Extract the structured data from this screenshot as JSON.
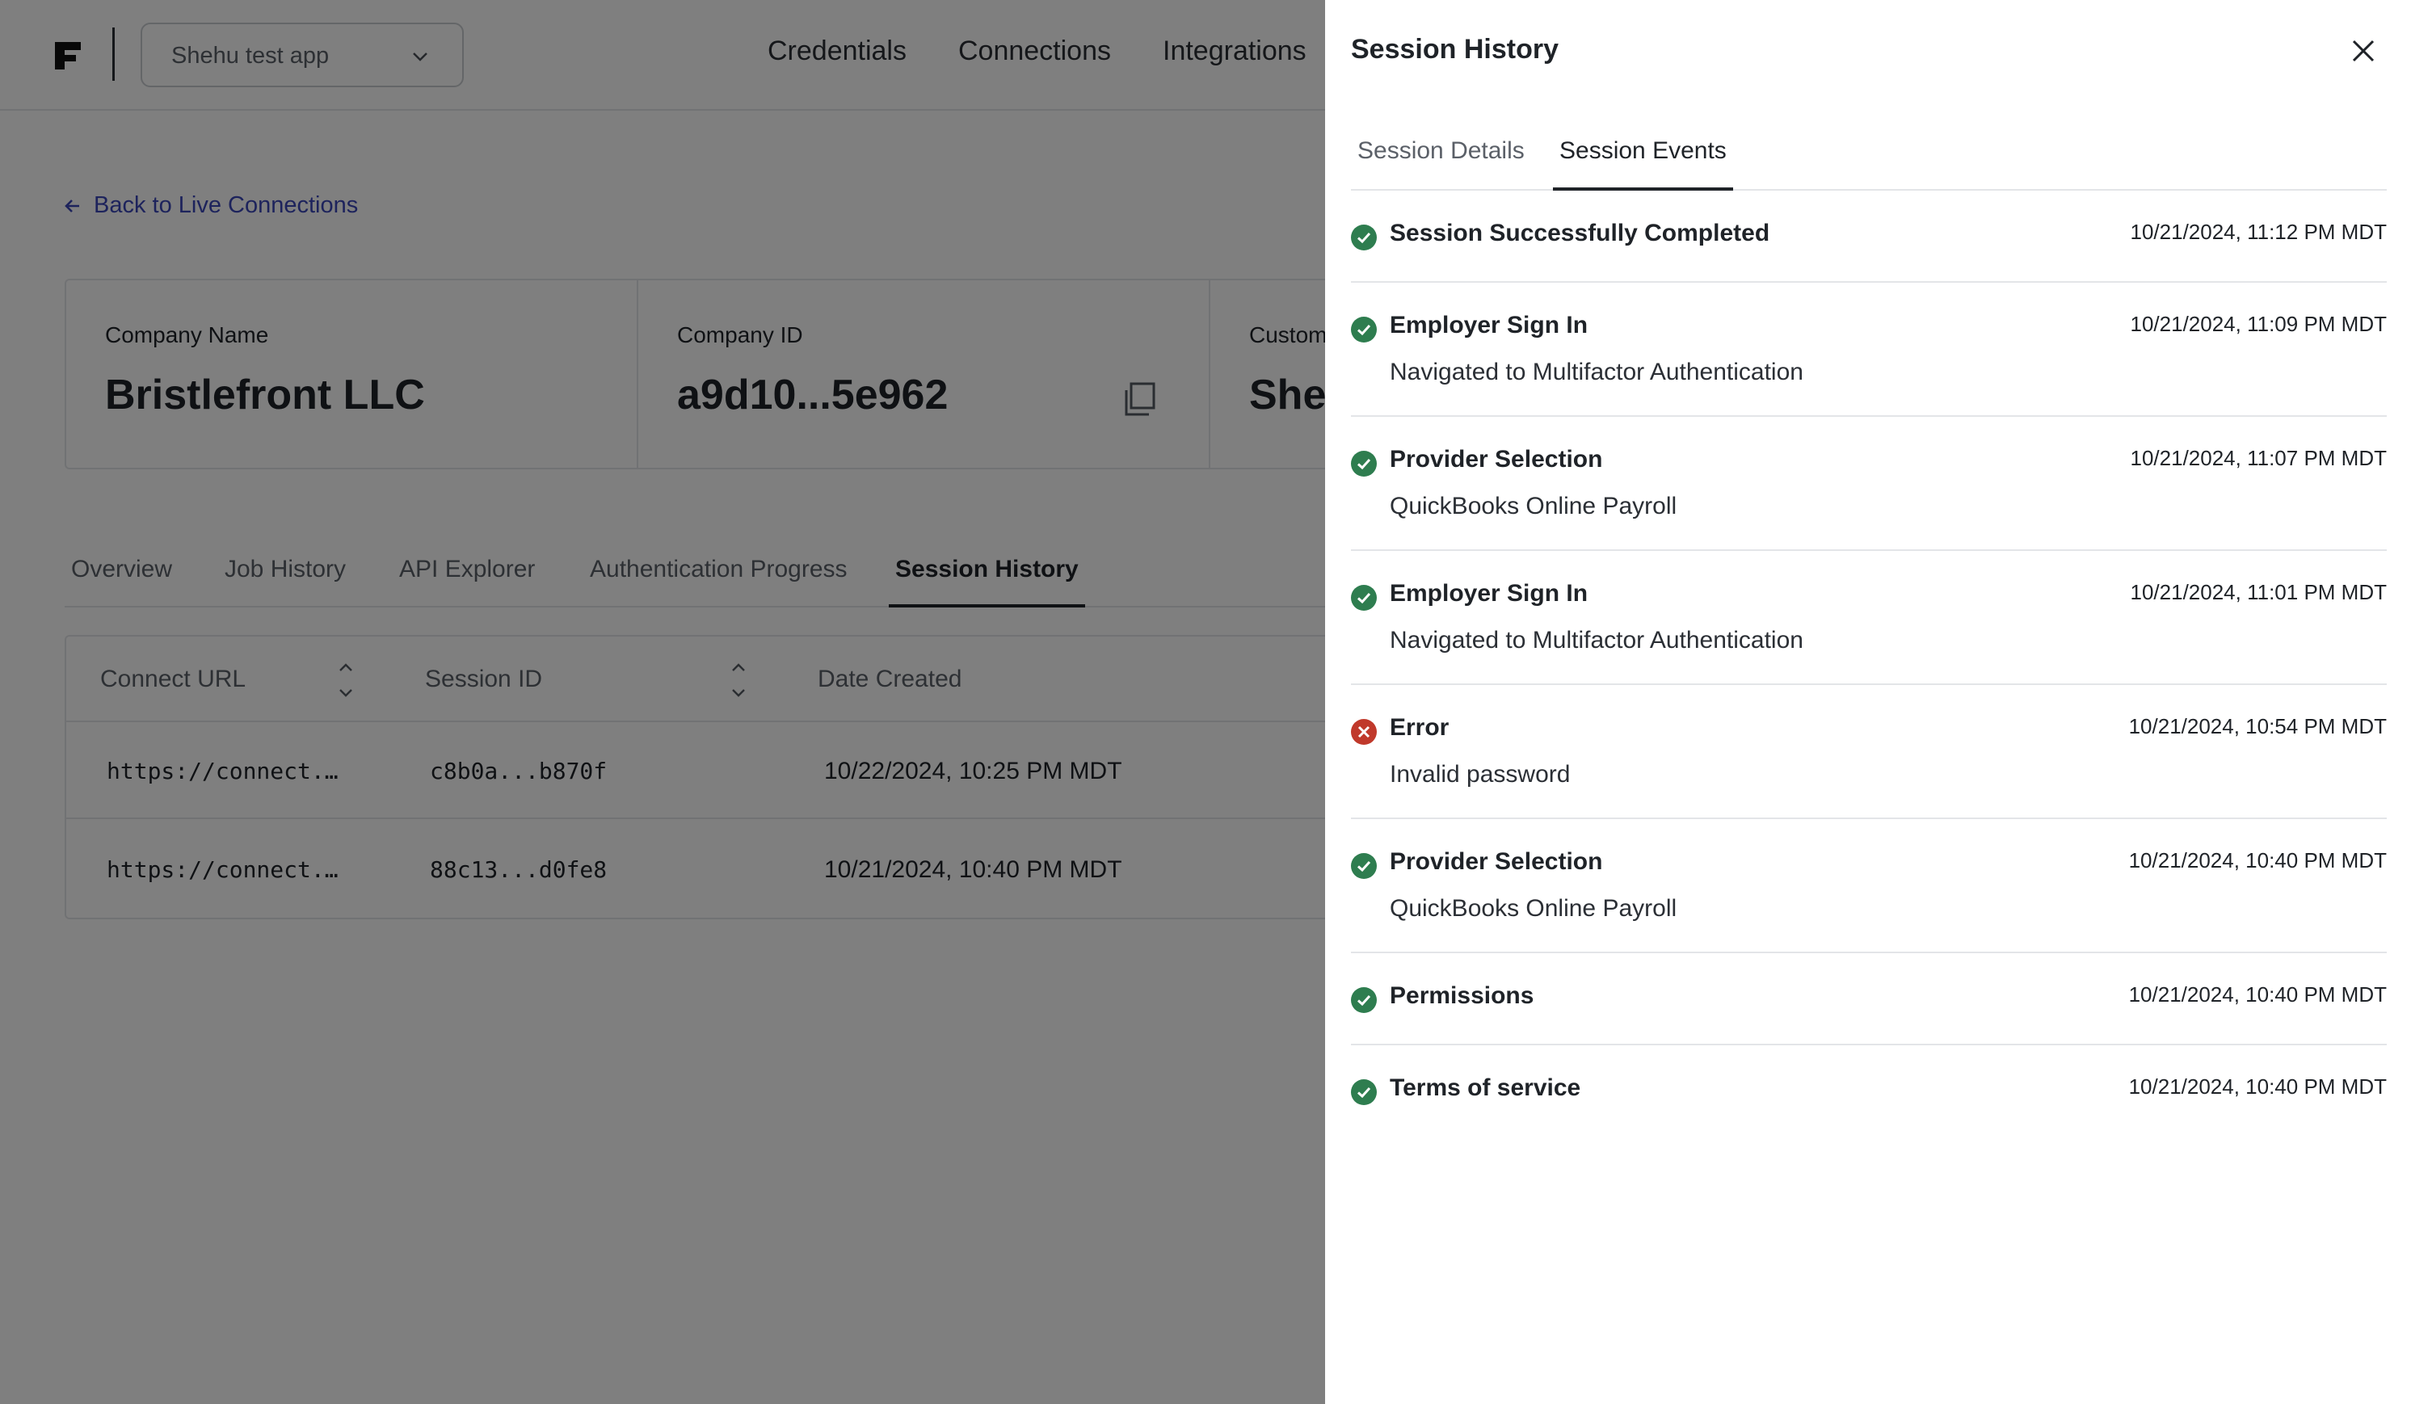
{
  "nav": {
    "app_selector": "Shehu test app",
    "links": [
      "Credentials",
      "Connections",
      "Integrations"
    ]
  },
  "back_link": "Back to Live Connections",
  "info_cards": [
    {
      "label": "Company Name",
      "value": "Bristlefront LLC"
    },
    {
      "label": "Company ID",
      "value": "a9d10...5e962"
    },
    {
      "label": "Custom",
      "value": "Shel"
    }
  ],
  "tabs": [
    "Overview",
    "Job History",
    "API Explorer",
    "Authentication Progress",
    "Session History"
  ],
  "active_tab": "Session History",
  "table": {
    "columns": [
      "Connect URL",
      "Session ID",
      "Date Created"
    ],
    "rows": [
      {
        "url": "https://connect.…",
        "session_id": "c8b0a...b870f",
        "date": "10/22/2024, 10:25 PM MDT"
      },
      {
        "url": "https://connect.…",
        "session_id": "88c13...d0fe8",
        "date": "10/21/2024, 10:40 PM MDT"
      }
    ]
  },
  "drawer": {
    "title": "Session History",
    "tabs": [
      "Session Details",
      "Session Events"
    ],
    "active_tab": "Session Events",
    "events": [
      {
        "status": "success",
        "title": "Session Successfully Completed",
        "time": "10/21/2024, 11:12 PM MDT",
        "detail": ""
      },
      {
        "status": "success",
        "title": "Employer Sign In",
        "time": "10/21/2024, 11:09 PM MDT",
        "detail": "Navigated to Multifactor Authentication"
      },
      {
        "status": "success",
        "title": "Provider Selection",
        "time": "10/21/2024, 11:07 PM MDT",
        "detail": "QuickBooks Online Payroll"
      },
      {
        "status": "success",
        "title": "Employer Sign In",
        "time": "10/21/2024, 11:01 PM MDT",
        "detail": "Navigated to Multifactor Authentication"
      },
      {
        "status": "error",
        "title": "Error",
        "time": "10/21/2024, 10:54 PM MDT",
        "detail": "Invalid password"
      },
      {
        "status": "success",
        "title": "Provider Selection",
        "time": "10/21/2024, 10:40 PM MDT",
        "detail": "QuickBooks Online Payroll"
      },
      {
        "status": "success",
        "title": "Permissions",
        "time": "10/21/2024, 10:40 PM MDT",
        "detail": ""
      },
      {
        "status": "success",
        "title": "Terms of service",
        "time": "10/21/2024, 10:40 PM MDT",
        "detail": ""
      }
    ]
  },
  "colors": {
    "success": "#2e7d4f",
    "error": "#c0392b",
    "link": "#3a46b8"
  }
}
